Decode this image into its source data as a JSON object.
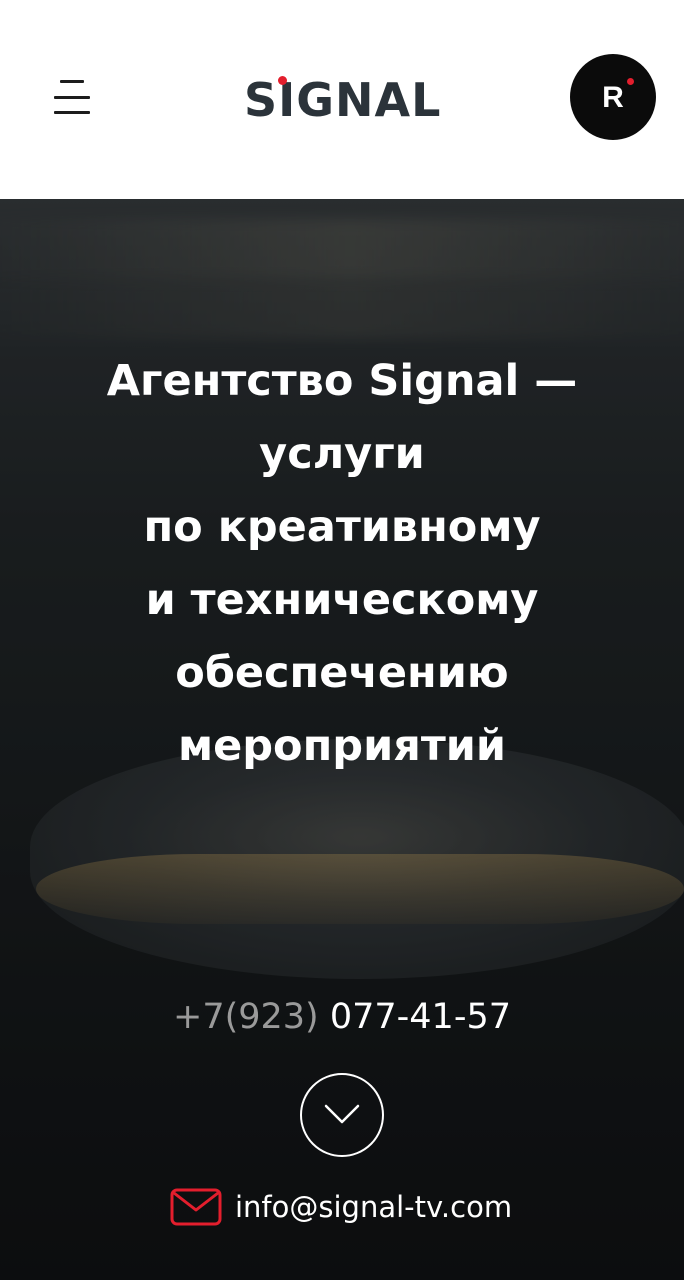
{
  "header": {
    "logo_text": "SIGNAL",
    "badge_letter": "R"
  },
  "hero": {
    "headline": "Агентство Signal —\nуслуги\nпо креативному\nи техническому\nобеспечению\nмероприятий",
    "phone_prefix": "+7(923)",
    "phone_number": "077-41-57",
    "email": "info@signal-tv.com"
  },
  "colors": {
    "accent_red": "#e31e2d",
    "logo_dark": "#2b333a",
    "white": "#ffffff"
  },
  "icons": {
    "menu": "hamburger-icon",
    "scroll": "chevron-down-icon",
    "email": "envelope-icon"
  }
}
